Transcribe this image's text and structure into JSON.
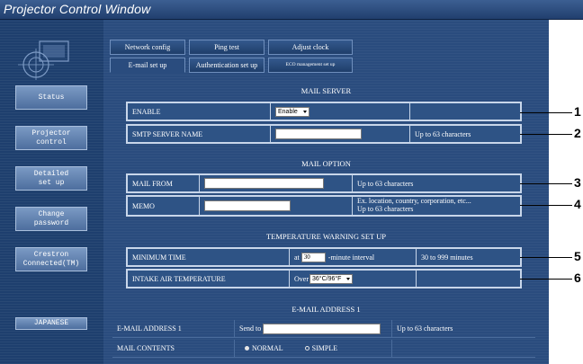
{
  "window": {
    "title": "Projector Control Window"
  },
  "sidebar": {
    "items": [
      {
        "label": "Status"
      },
      {
        "label": "Projector\ncontrol"
      },
      {
        "label": "Detailed\nset up"
      },
      {
        "label": "Change\npassword"
      },
      {
        "label": "Crestron\nConnected(TM)"
      }
    ],
    "language": "JAPANESE"
  },
  "tabs": {
    "row1": [
      "Network config",
      "Ping test",
      "Adjust clock"
    ],
    "row2": [
      "E-mail set up",
      "Authentication set up",
      "ECO management set up"
    ],
    "active": "E-mail set up"
  },
  "mail_server": {
    "title": "MAIL SERVER",
    "enable_label": "ENABLE",
    "enable_value": "Enable",
    "smtp_label": "SMTP SERVER NAME",
    "smtp_value": "",
    "smtp_note": "Up to 63 characters"
  },
  "mail_option": {
    "title": "MAIL OPTION",
    "from_label": "MAIL FROM",
    "from_value": "",
    "from_note": "Up to 63 characters",
    "memo_label": "MEMO",
    "memo_value": "",
    "memo_note_1": "Ex. location, country, corporation, etc...",
    "memo_note_2": "Up to 63 characters"
  },
  "temp_warning": {
    "title": "TEMPERATURE WARNING SET UP",
    "min_time_label": "MINIMUM TIME",
    "at_label": "at",
    "min_time_value": "30",
    "interval_label": "-minute interval",
    "min_time_note": "30 to 999 minutes",
    "intake_label": "INTAKE AIR TEMPERATURE",
    "over_label": "Over",
    "intake_value": "36°C/96°F"
  },
  "email_address_1": {
    "title": "E-MAIL ADDRESS 1",
    "address_label": "E-MAIL ADDRESS 1",
    "send_to_label": "Send to",
    "address_value": "",
    "address_note": "Up to 63 characters",
    "contents_label": "MAIL CONTENTS",
    "option_normal": "NORMAL",
    "option_simple": "SIMPLE",
    "selected": "NORMAL"
  },
  "callouts": [
    "1",
    "2",
    "3",
    "4",
    "5",
    "6"
  ]
}
